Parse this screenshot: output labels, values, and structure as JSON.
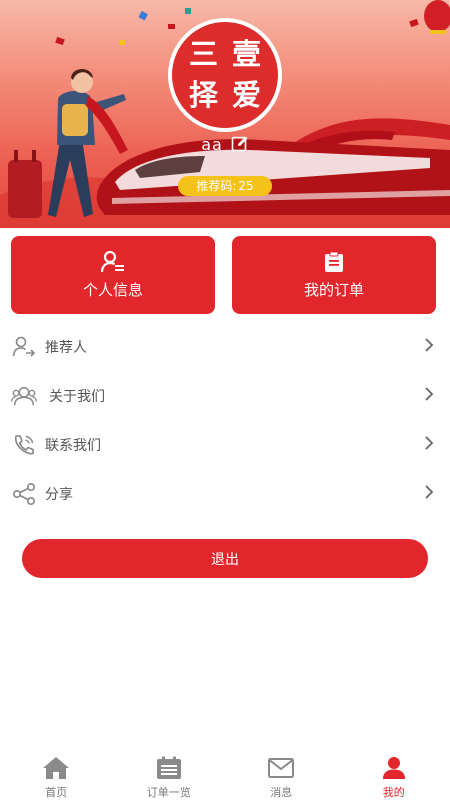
{
  "profile": {
    "avatar_chars": [
      "三",
      "壹",
      "择",
      "爱"
    ],
    "username": "aa",
    "referral_label": "推荐码:",
    "referral_code": "25"
  },
  "cards": [
    {
      "label": "个人信息",
      "icon": "user-list-icon"
    },
    {
      "label": "我的订单",
      "icon": "clipboard-icon"
    }
  ],
  "menu": [
    {
      "label": "推荐人",
      "icon": "user-arrow-icon"
    },
    {
      "label": "关于我们",
      "icon": "users-icon"
    },
    {
      "label": "联系我们",
      "icon": "phone-icon"
    },
    {
      "label": "分享",
      "icon": "share-icon"
    }
  ],
  "logout_label": "退出",
  "nav": [
    {
      "label": "首页",
      "icon": "home-icon",
      "active": false
    },
    {
      "label": "订单一览",
      "icon": "calendar-list-icon",
      "active": false
    },
    {
      "label": "消息",
      "icon": "mail-icon",
      "active": false
    },
    {
      "label": "我的",
      "icon": "person-icon",
      "active": true
    }
  ],
  "colors": {
    "primary": "#e1262c",
    "badge": "#f5c21a",
    "nav_inactive": "#777777",
    "icon_gray": "#888888"
  }
}
